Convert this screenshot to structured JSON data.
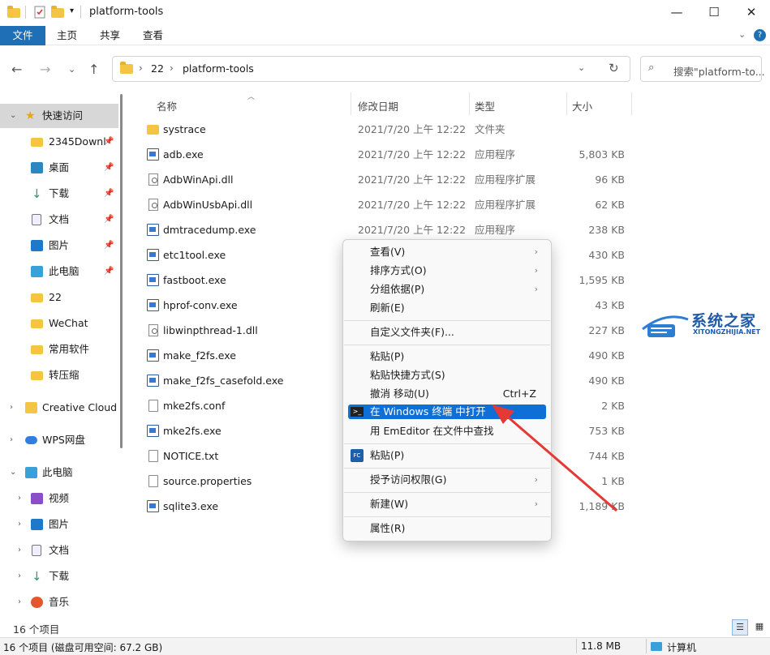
{
  "window": {
    "title": "platform-tools"
  },
  "ribbon": {
    "tabs": [
      "文件",
      "主页",
      "共享",
      "查看"
    ]
  },
  "address": {
    "segments": [
      "22",
      "platform-tools"
    ],
    "separator": "›"
  },
  "search": {
    "placeholder": "搜索\"platform-to..."
  },
  "sidebar": {
    "items": [
      {
        "label": "快速访问",
        "icon": "star-icon"
      },
      {
        "label": "2345Downl",
        "icon": "folder-icon"
      },
      {
        "label": "桌面",
        "icon": "desktop-icon"
      },
      {
        "label": "下载",
        "icon": "download-icon"
      },
      {
        "label": "文档",
        "icon": "document-icon"
      },
      {
        "label": "图片",
        "icon": "picture-icon"
      },
      {
        "label": "此电脑",
        "icon": "computer-icon"
      },
      {
        "label": "22",
        "icon": "folder-icon"
      },
      {
        "label": "WeChat",
        "icon": "folder-icon"
      },
      {
        "label": "常用软件",
        "icon": "folder-icon"
      },
      {
        "label": "转压缩",
        "icon": "folder-icon"
      },
      {
        "label": "Creative Cloud",
        "icon": "creative-cloud-icon"
      },
      {
        "label": "WPS网盘",
        "icon": "cloud-icon"
      },
      {
        "label": "此电脑",
        "icon": "computer-icon"
      },
      {
        "label": "视频",
        "icon": "video-icon"
      },
      {
        "label": "图片",
        "icon": "picture-icon"
      },
      {
        "label": "文档",
        "icon": "document-icon"
      },
      {
        "label": "下载",
        "icon": "download-icon"
      },
      {
        "label": "音乐",
        "icon": "music-icon"
      }
    ]
  },
  "columns": {
    "name": "名称",
    "date": "修改日期",
    "type": "类型",
    "size": "大小"
  },
  "files": [
    {
      "name": "systrace",
      "date": "2021/7/20 上午 12:22",
      "type": "文件夹",
      "size": "",
      "icon": "folder"
    },
    {
      "name": "adb.exe",
      "date": "2021/7/20 上午 12:22",
      "type": "应用程序",
      "size": "5,803 KB",
      "icon": "exe"
    },
    {
      "name": "AdbWinApi.dll",
      "date": "2021/7/20 上午 12:22",
      "type": "应用程序扩展",
      "size": "96 KB",
      "icon": "dll"
    },
    {
      "name": "AdbWinUsbApi.dll",
      "date": "2021/7/20 上午 12:22",
      "type": "应用程序扩展",
      "size": "62 KB",
      "icon": "dll"
    },
    {
      "name": "dmtracedump.exe",
      "date": "2021/7/20 上午 12:22",
      "type": "应用程序",
      "size": "238 KB",
      "icon": "exe"
    },
    {
      "name": "etc1tool.exe",
      "date": "",
      "type": "",
      "size": "430 KB",
      "icon": "exe"
    },
    {
      "name": "fastboot.exe",
      "date": "",
      "type": "",
      "size": "1,595 KB",
      "icon": "exe"
    },
    {
      "name": "hprof-conv.exe",
      "date": "",
      "type": "",
      "size": "43 KB",
      "icon": "exe"
    },
    {
      "name": "libwinpthread-1.dll",
      "date": "",
      "type": "",
      "size": "227 KB",
      "icon": "dll"
    },
    {
      "name": "make_f2fs.exe",
      "date": "",
      "type": "",
      "size": "490 KB",
      "icon": "exe"
    },
    {
      "name": "make_f2fs_casefold.exe",
      "date": "",
      "type": "",
      "size": "490 KB",
      "icon": "exe"
    },
    {
      "name": "mke2fs.conf",
      "date": "",
      "type": "",
      "size": "2 KB",
      "icon": "doc"
    },
    {
      "name": "mke2fs.exe",
      "date": "",
      "type": "",
      "size": "753 KB",
      "icon": "exe"
    },
    {
      "name": "NOTICE.txt",
      "date": "",
      "type": "",
      "size": "744 KB",
      "icon": "doc"
    },
    {
      "name": "source.properties",
      "date": "",
      "type": "",
      "size": "1 KB",
      "icon": "doc"
    },
    {
      "name": "sqlite3.exe",
      "date": "",
      "type": "",
      "size": "1,189 KB",
      "icon": "exe"
    }
  ],
  "context_menu": {
    "items": [
      {
        "label": "查看(V)",
        "submenu": true
      },
      {
        "label": "排序方式(O)",
        "submenu": true
      },
      {
        "label": "分组依据(P)",
        "submenu": true
      },
      {
        "label": "刷新(E)"
      },
      {
        "label": "自定义文件夹(F)..."
      },
      {
        "label": "粘贴(P)"
      },
      {
        "label": "粘贴快捷方式(S)"
      },
      {
        "label": "撤消 移动(U)",
        "shortcut": "Ctrl+Z"
      },
      {
        "label": "在 Windows 终端 中打开",
        "highlighted": true
      },
      {
        "label": "用 EmEditor 在文件中查找"
      },
      {
        "label": "粘贴(P)"
      },
      {
        "label": "授予访问权限(G)",
        "submenu": true
      },
      {
        "label": "新建(W)",
        "submenu": true
      },
      {
        "label": "属性(R)"
      }
    ]
  },
  "status": {
    "item_count": "16 个项目"
  },
  "taskbar": {
    "left": "16 个项目 (磁盘可用空间: 67.2 GB)",
    "size": "11.8 MB",
    "location": "计算机"
  },
  "watermark": {
    "title": "系统之家",
    "subtitle": "XITONGZHIJIA.NET"
  },
  "colors": {
    "accent": "#0e6fd6",
    "ribbon_file": "#1f6fb6",
    "arrow": "#e53935"
  }
}
